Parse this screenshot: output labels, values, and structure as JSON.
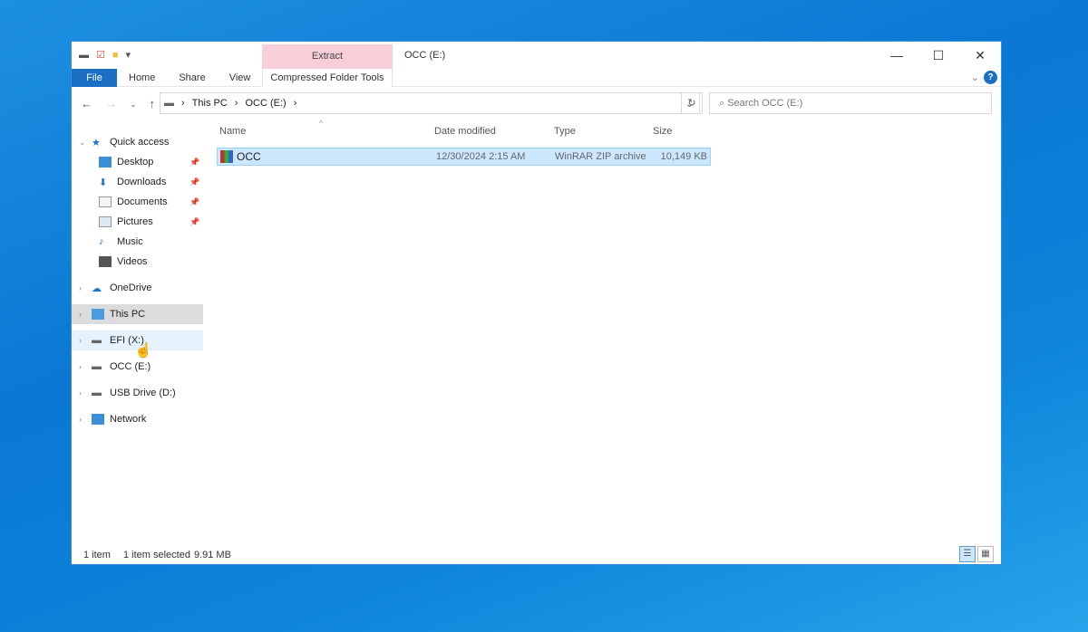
{
  "window": {
    "title": "OCC (E:)",
    "contextual_group": "Extract",
    "contextual_tab": "Compressed Folder Tools"
  },
  "ribbon_tabs": [
    "File",
    "Home",
    "Share",
    "View"
  ],
  "address": {
    "crumbs": [
      "This PC",
      "OCC (E:)"
    ]
  },
  "search": {
    "placeholder": "Search OCC (E:)"
  },
  "sidebar": {
    "quick_access": "Quick access",
    "pinned": [
      {
        "label": "Desktop",
        "pinned": true
      },
      {
        "label": "Downloads",
        "pinned": true
      },
      {
        "label": "Documents",
        "pinned": true
      },
      {
        "label": "Pictures",
        "pinned": true
      },
      {
        "label": "Music",
        "pinned": false
      },
      {
        "label": "Videos",
        "pinned": false
      }
    ],
    "roots": [
      "OneDrive",
      "This PC",
      "EFI (X:)",
      "OCC (E:)",
      "USB Drive (D:)",
      "Network"
    ]
  },
  "columns": [
    "Name",
    "Date modified",
    "Type",
    "Size"
  ],
  "files": [
    {
      "name": "OCC",
      "date": "12/30/2024 2:15 AM",
      "type": "WinRAR ZIP archive",
      "size": "10,149 KB"
    }
  ],
  "status": {
    "count": "1 item",
    "selected": "1 item selected",
    "size": "9.91 MB"
  }
}
